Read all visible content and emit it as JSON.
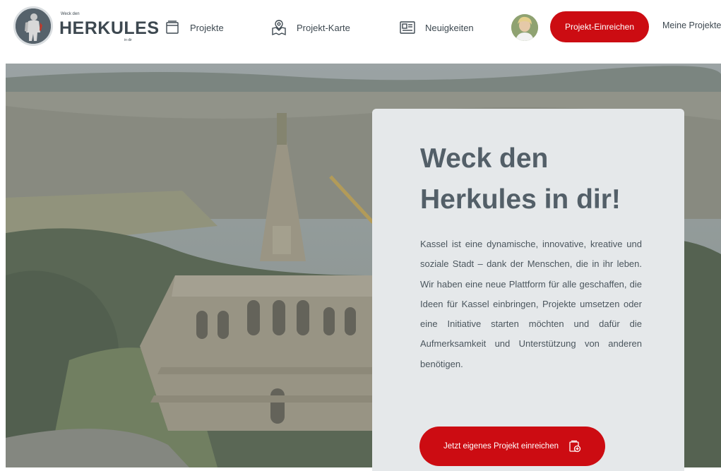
{
  "logo": {
    "small": "Weck den",
    "main": "HERKULES",
    "suffix": "in dir"
  },
  "nav": {
    "items": [
      {
        "label": "Projekte",
        "icon": "folder-icon"
      },
      {
        "label": "Projekt-Karte",
        "icon": "map-pin-icon"
      },
      {
        "label": "Neuigkeiten",
        "icon": "newspaper-icon"
      }
    ],
    "submit_label": "Projekt-Einreichen",
    "my_projects_label": "Meine Projekte"
  },
  "hero": {
    "title_line1": "Weck den",
    "title_line2": "Herkules in dir!",
    "text": "Kassel ist eine dynamische, innovative, kreative und soziale Stadt – dank der Menschen, die in ihr leben. Wir haben eine neue Plattform für alle geschaffen, die Ideen für Kassel einbringen, Projekte umsetzen oder eine Initiative starten möchten und dafür die Aufmerksamkeit und Unterstützung von anderen benötigen.",
    "cta_label": "Jetzt eigenes Projekt einreichen"
  },
  "colors": {
    "accent": "#cc0c12",
    "text": "#3d4850",
    "card": "#e5e8ea"
  }
}
